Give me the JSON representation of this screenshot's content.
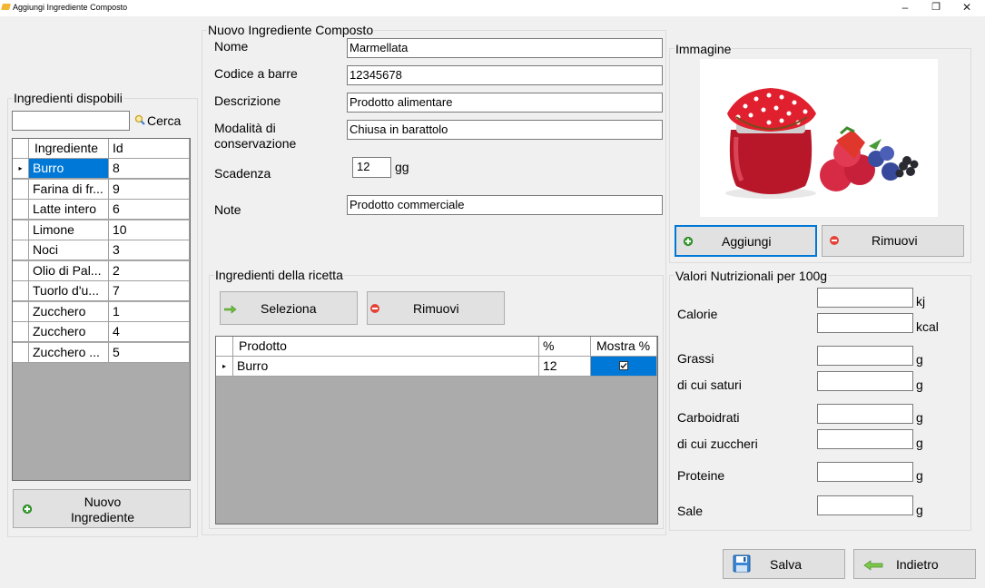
{
  "window": {
    "title": "Aggiungi Ingrediente Composto",
    "controls": [
      "–",
      "❐",
      "✕"
    ]
  },
  "left_panel": {
    "group_title": "Ingredienti dispobili",
    "search_value": "",
    "search_label": "Cerca",
    "grid": {
      "headers": [
        "Ingrediente",
        "Id"
      ],
      "rows": [
        [
          "Burro",
          "8"
        ],
        [
          "Farina di fr...",
          "9"
        ],
        [
          "Latte intero",
          "6"
        ],
        [
          "Limone",
          "10"
        ],
        [
          "Noci",
          "3"
        ],
        [
          "Olio di Pal...",
          "2"
        ],
        [
          "Tuorlo d'u...",
          "7"
        ],
        [
          "Zucchero",
          "1"
        ],
        [
          "Zucchero",
          "4"
        ],
        [
          "Zucchero ...",
          "5"
        ]
      ],
      "current_row_marker": "▸"
    },
    "new_button": {
      "line1": "Nuovo",
      "line2": "Ingrediente"
    }
  },
  "form": {
    "group_title": "Nuovo Ingrediente Composto",
    "nome_label": "Nome",
    "nome_value": "Marmellata",
    "barcode_label": "Codice a barre",
    "barcode_value": "12345678",
    "descrizione_label": "Descrizione",
    "descrizione_value": "Prodotto alimentare",
    "conservazione_label_1": "Modalità di",
    "conservazione_label_2": "conservazione",
    "conservazione_value": "Chiusa in barattolo",
    "scadenza_label": "Scadenza",
    "scadenza_value": "12",
    "scadenza_unit": "gg",
    "note_label": "Note",
    "note_value": "Prodotto commerciale"
  },
  "recipe": {
    "group_title": "Ingredienti della ricetta",
    "select_button": "Seleziona",
    "remove_button": "Rimuovi",
    "grid": {
      "headers": [
        "Prodotto",
        "%",
        "Mostra %"
      ],
      "rows": [
        {
          "prodotto": "Burro",
          "percent": "12",
          "mostra": true
        }
      ]
    }
  },
  "image_panel": {
    "group_title": "Immagine",
    "add_button": "Aggiungi",
    "remove_button": "Rimuovi"
  },
  "nutrition": {
    "group_title": "Valori Nutrizionali per 100g",
    "calorie_label": "Calorie",
    "calorie_unit_kj": "kj",
    "calorie_unit_kcal": "kcal",
    "grassi_label": "Grassi",
    "saturi_label": "di cui saturi",
    "carboidrati_label": "Carboidrati",
    "zuccheri_label": "di cui zuccheri",
    "proteine_label": "Proteine",
    "sale_label": "Sale",
    "unit_g": "g"
  },
  "footer": {
    "save_button": "Salva",
    "back_button": "Indietro"
  },
  "colors": {
    "selection": "#0078d7",
    "window_bg": "#f0f0f0",
    "grid_bg": "#ababab"
  }
}
